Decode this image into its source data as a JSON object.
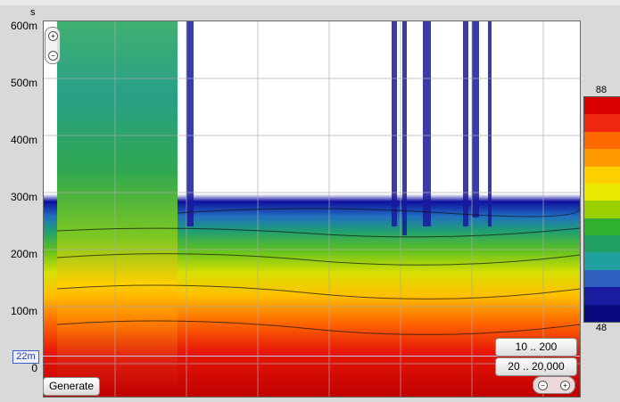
{
  "axes": {
    "y_unit": "s",
    "y_ticks": [
      "600m",
      "500m",
      "400m",
      "300m",
      "200m",
      "100m",
      "0"
    ]
  },
  "cursor": {
    "label": "22m"
  },
  "buttons": {
    "generate": "Generate",
    "range_a": "10 .. 200",
    "range_b": "20 .. 20,000"
  },
  "legend": {
    "max": "88",
    "min": "48",
    "colors": [
      "#d80000",
      "#f02810",
      "#ff6a00",
      "#ff9a00",
      "#ffd000",
      "#e8e800",
      "#9ad000",
      "#2fb02f",
      "#20a060",
      "#20a0a0",
      "#3060c0",
      "#1b1ba0",
      "#0a0a80"
    ]
  },
  "icons": {
    "zoom_in": "plus-icon",
    "zoom_out": "minus-icon"
  }
}
